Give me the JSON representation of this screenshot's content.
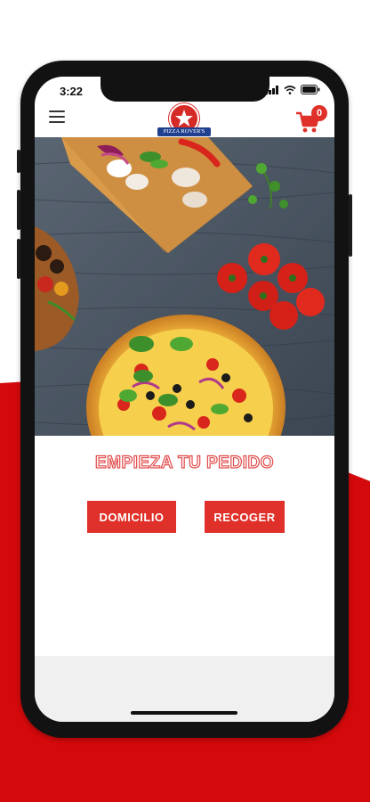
{
  "status_bar": {
    "time": "3:22"
  },
  "header": {
    "logo_text": "PIZZA ROVER'S",
    "cart_count": "0"
  },
  "main": {
    "title": "EMPIEZA TU PEDIDO",
    "delivery_label": "DOMICILIO",
    "pickup_label": "RECOGER"
  },
  "colors": {
    "brand_red": "#e0302a",
    "logo_blue": "#1f3f8f",
    "background_red": "#d4090b"
  },
  "icons": [
    "menu-icon",
    "cart-icon",
    "wifi-icon",
    "battery-icon",
    "signal-icon",
    "star-icon"
  ]
}
